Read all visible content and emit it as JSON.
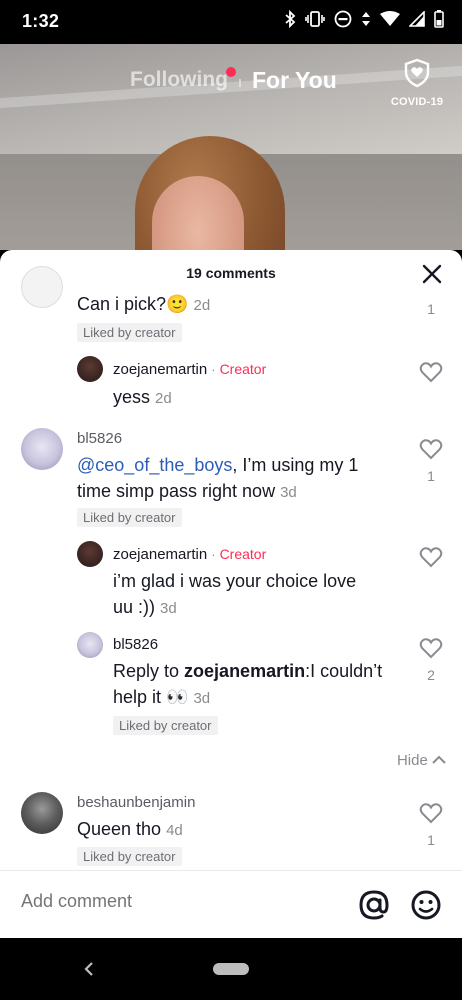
{
  "status_bar": {
    "time": "1:32"
  },
  "top_nav": {
    "following": "Following",
    "for_you": "For You",
    "covid_label": "COVID-19"
  },
  "sheet": {
    "title": "19 comments"
  },
  "comments": [
    {
      "username": "",
      "text": "Can i pick?",
      "emoji": "🙂",
      "time": "2d",
      "liked_badge": "Liked by creator",
      "likes": "1"
    },
    {
      "username": "zoejanemartin",
      "creator_label": "Creator",
      "sep": "·",
      "text": "yess",
      "time": "2d"
    },
    {
      "username": "bl5826",
      "mention": "@ceo_of_the_boys",
      "text_line1": ", I’m using my 1",
      "text_line2": "time simp pass right now",
      "time": "3d",
      "liked_badge": "Liked by creator",
      "likes": "1"
    },
    {
      "username": "zoejanemartin",
      "creator_label": "Creator",
      "sep": "·",
      "text_line1": "i’m glad i was your choice love",
      "text_line2": "uu :))",
      "time": "3d"
    },
    {
      "username": "bl5826",
      "reply_prefix": "Reply to ",
      "reply_target": "zoejanemartin",
      "text_line1": ":I couldn’t",
      "text_line2": "help it 👀",
      "time": "3d",
      "liked_badge": "Liked by creator",
      "likes": "2"
    },
    {
      "username": "beshaunbenjamin",
      "text": "Queen tho",
      "time": "4d",
      "liked_badge": "Liked by creator",
      "likes": "1"
    }
  ],
  "hide_link": "Hide",
  "add_comment": {
    "placeholder": "Add comment"
  },
  "colors": {
    "accent": "#fe2c55",
    "mention": "#2b5db8",
    "sheet_bg": "#ffffff"
  }
}
